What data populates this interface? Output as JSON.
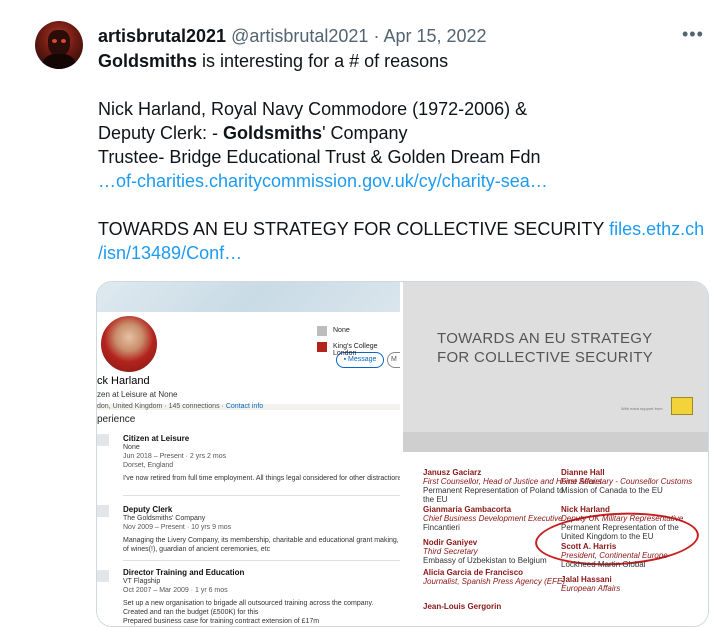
{
  "tweet": {
    "display_name": "artisbrutal2021",
    "handle": "@artisbrutal2021",
    "separator": "·",
    "date": "Apr 15, 2022",
    "more_icon": "more-horizontal-icon",
    "line1_bold": "Goldsmiths",
    "line1_rest": " is interesting for a # of reasons",
    "line2": "Nick Harland, Royal Navy Commodore (1972-2006) &",
    "line3_pre": "Deputy Clerk: - ",
    "line3_bold": "Goldsmiths",
    "line3_post": "' Company",
    "line4": "Trustee- Bridge Educational Trust & Golden Dream Fdn",
    "link1": "…of-charities.charitycommission.gov.uk/cy/charity-sea…",
    "line5": "TOWARDS AN EU STRATEGY FOR COLLECTIVE SECURITY ",
    "link2a": "files.ethz.ch",
    "link2b": "/isn/13489/Conf…"
  },
  "linkedin": {
    "name": "ck Harland",
    "headline": "zen at Leisure at None",
    "location": "don, United Kingdom · 145 connections · ",
    "contact_info": "Contact info",
    "message_button": "Message",
    "more_button": "M",
    "edu1": "None",
    "edu2": "King's College London",
    "experience_title": "perience",
    "jobs": [
      {
        "title": "Citizen at Leisure",
        "company": "None",
        "dates": "Jun 2018 – Present · 2 yrs 2 mos",
        "location": "Dorset, England",
        "desc": [
          "I've now retired from full time employment. All things legal considered for other distractions."
        ]
      },
      {
        "title": "Deputy Clerk",
        "company": "The Goldsmiths' Company",
        "dates": "Nov 2009 – Present · 10 yrs 9 mos",
        "location": "",
        "desc": [
          "Managing the Livery Company, its membership, charitable and educational grant making, in charge",
          "of wines(!), guardian of ancient ceremonies, etc"
        ]
      },
      {
        "title": "Director Training and Education",
        "company": "VT Flagship",
        "dates": "Oct 2007 – Mar 2009 · 1 yr 6 mos",
        "location": "",
        "desc": [
          "Set up a new organisation to brigade all outsourced training across the company.",
          "Created and ran the budget (£500K) for this",
          "Prepared business case for training contract extension of £17m"
        ]
      }
    ]
  },
  "document": {
    "title_line1": "TOWARDS AN EU STRATEGY",
    "title_line2": "FOR COLLECTIVE SECURITY",
    "subtitle": "With extra support from"
  },
  "names_list": [
    {
      "name": "Janusz Gaciarz",
      "role": "First Counsellor, Head of Justice and Home Affairs",
      "org": "Permanent Representation of Poland to the EU",
      "col": 0,
      "row": 0
    },
    {
      "name": "Gianmaria Gambacorta",
      "role": "Chief Business Development Executive",
      "org": "Fincantieri",
      "col": 0,
      "row": 1
    },
    {
      "name": "Nodir Ganiyev",
      "role": "Third Secretary",
      "org": "Embassy of Uzbekistan to Belgium",
      "col": 0,
      "row": 2
    },
    {
      "name": "Alicia Garcia de Francisco",
      "role": "Journalist, Spanish Press Agency (EFE)",
      "org": "",
      "col": 0,
      "row": 3
    },
    {
      "name": "Jean-Louis Gergorin",
      "role": "",
      "org": "",
      "col": 0,
      "row": 4
    },
    {
      "name": "Dianne Hall",
      "role": "First Secretary - Counsellor Customs",
      "org": "Mission of Canada to the EU",
      "col": 1,
      "row": 0
    },
    {
      "name": "Nick Harland",
      "role": "Deputy UK Military Representative",
      "org": "Permanent Representation of the United Kingdom to the EU",
      "col": 1,
      "row": 1
    },
    {
      "name": "Scott A. Harris",
      "role": "President, Continental Europe",
      "org": "Lockheed Martin Global",
      "col": 1,
      "row": 2
    },
    {
      "name": "Jalal Hassani",
      "role": "European Affairs",
      "org": "",
      "col": 1,
      "row": 3
    }
  ]
}
